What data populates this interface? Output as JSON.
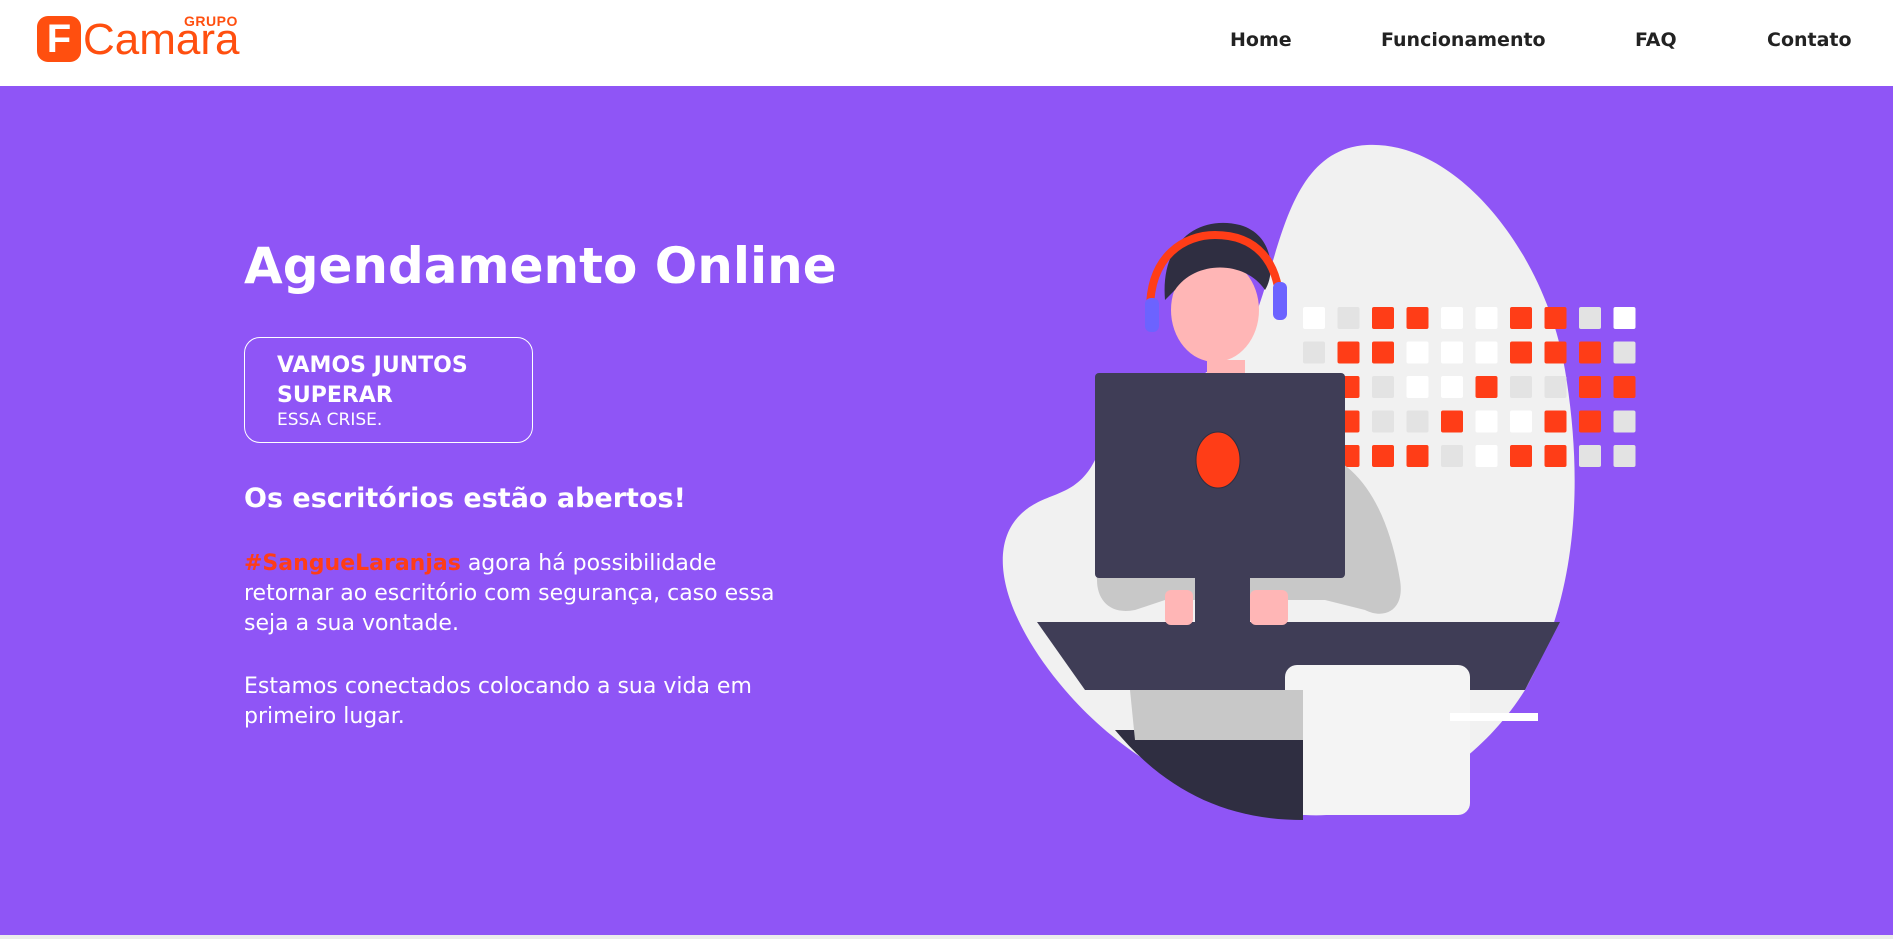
{
  "header": {
    "logo": {
      "letter": "F",
      "word": "Camara",
      "group": "GRUPO",
      "brand_color": "#ff4f0f"
    },
    "nav": [
      {
        "label": "Home"
      },
      {
        "label": "Funcionamento"
      },
      {
        "label": "FAQ"
      },
      {
        "label": "Contato"
      }
    ]
  },
  "hero": {
    "background": "#8f55f6",
    "title": "Agendamento Online",
    "badge": {
      "line1": "VAMOS JUNTOS SUPERAR",
      "line2": "ESSA CRISE."
    },
    "subtitle": "Os escritórios estão abertos!",
    "paragraph1": {
      "hashtag": "#SangueLaranjas",
      "text": " agora há possibilidade retornar ao escritório com segurança, caso essa seja a sua vontade."
    },
    "paragraph2": "Estamos conectados colocando a sua vida em primeiro lugar.",
    "accent_color": "#ff3d17",
    "illustration": "person-with-headset-at-computer"
  }
}
